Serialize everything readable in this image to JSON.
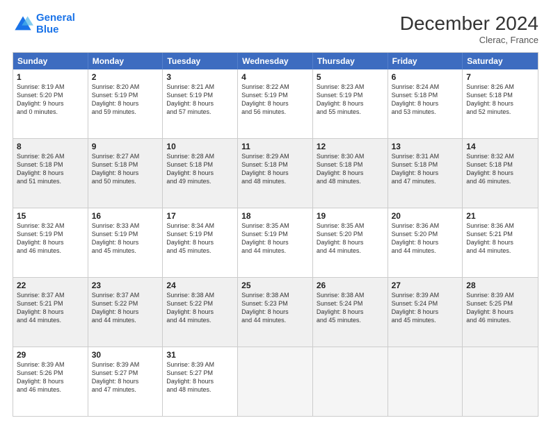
{
  "logo": {
    "line1": "General",
    "line2": "Blue"
  },
  "title": "December 2024",
  "subtitle": "Clerac, France",
  "header_days": [
    "Sunday",
    "Monday",
    "Tuesday",
    "Wednesday",
    "Thursday",
    "Friday",
    "Saturday"
  ],
  "weeks": [
    [
      {
        "day": "1",
        "lines": [
          "Sunrise: 8:19 AM",
          "Sunset: 5:20 PM",
          "Daylight: 9 hours",
          "and 0 minutes."
        ]
      },
      {
        "day": "2",
        "lines": [
          "Sunrise: 8:20 AM",
          "Sunset: 5:19 PM",
          "Daylight: 8 hours",
          "and 59 minutes."
        ]
      },
      {
        "day": "3",
        "lines": [
          "Sunrise: 8:21 AM",
          "Sunset: 5:19 PM",
          "Daylight: 8 hours",
          "and 57 minutes."
        ]
      },
      {
        "day": "4",
        "lines": [
          "Sunrise: 8:22 AM",
          "Sunset: 5:19 PM",
          "Daylight: 8 hours",
          "and 56 minutes."
        ]
      },
      {
        "day": "5",
        "lines": [
          "Sunrise: 8:23 AM",
          "Sunset: 5:19 PM",
          "Daylight: 8 hours",
          "and 55 minutes."
        ]
      },
      {
        "day": "6",
        "lines": [
          "Sunrise: 8:24 AM",
          "Sunset: 5:18 PM",
          "Daylight: 8 hours",
          "and 53 minutes."
        ]
      },
      {
        "day": "7",
        "lines": [
          "Sunrise: 8:26 AM",
          "Sunset: 5:18 PM",
          "Daylight: 8 hours",
          "and 52 minutes."
        ]
      }
    ],
    [
      {
        "day": "8",
        "lines": [
          "Sunrise: 8:26 AM",
          "Sunset: 5:18 PM",
          "Daylight: 8 hours",
          "and 51 minutes."
        ]
      },
      {
        "day": "9",
        "lines": [
          "Sunrise: 8:27 AM",
          "Sunset: 5:18 PM",
          "Daylight: 8 hours",
          "and 50 minutes."
        ]
      },
      {
        "day": "10",
        "lines": [
          "Sunrise: 8:28 AM",
          "Sunset: 5:18 PM",
          "Daylight: 8 hours",
          "and 49 minutes."
        ]
      },
      {
        "day": "11",
        "lines": [
          "Sunrise: 8:29 AM",
          "Sunset: 5:18 PM",
          "Daylight: 8 hours",
          "and 48 minutes."
        ]
      },
      {
        "day": "12",
        "lines": [
          "Sunrise: 8:30 AM",
          "Sunset: 5:18 PM",
          "Daylight: 8 hours",
          "and 48 minutes."
        ]
      },
      {
        "day": "13",
        "lines": [
          "Sunrise: 8:31 AM",
          "Sunset: 5:18 PM",
          "Daylight: 8 hours",
          "and 47 minutes."
        ]
      },
      {
        "day": "14",
        "lines": [
          "Sunrise: 8:32 AM",
          "Sunset: 5:18 PM",
          "Daylight: 8 hours",
          "and 46 minutes."
        ]
      }
    ],
    [
      {
        "day": "15",
        "lines": [
          "Sunrise: 8:32 AM",
          "Sunset: 5:19 PM",
          "Daylight: 8 hours",
          "and 46 minutes."
        ]
      },
      {
        "day": "16",
        "lines": [
          "Sunrise: 8:33 AM",
          "Sunset: 5:19 PM",
          "Daylight: 8 hours",
          "and 45 minutes."
        ]
      },
      {
        "day": "17",
        "lines": [
          "Sunrise: 8:34 AM",
          "Sunset: 5:19 PM",
          "Daylight: 8 hours",
          "and 45 minutes."
        ]
      },
      {
        "day": "18",
        "lines": [
          "Sunrise: 8:35 AM",
          "Sunset: 5:19 PM",
          "Daylight: 8 hours",
          "and 44 minutes."
        ]
      },
      {
        "day": "19",
        "lines": [
          "Sunrise: 8:35 AM",
          "Sunset: 5:20 PM",
          "Daylight: 8 hours",
          "and 44 minutes."
        ]
      },
      {
        "day": "20",
        "lines": [
          "Sunrise: 8:36 AM",
          "Sunset: 5:20 PM",
          "Daylight: 8 hours",
          "and 44 minutes."
        ]
      },
      {
        "day": "21",
        "lines": [
          "Sunrise: 8:36 AM",
          "Sunset: 5:21 PM",
          "Daylight: 8 hours",
          "and 44 minutes."
        ]
      }
    ],
    [
      {
        "day": "22",
        "lines": [
          "Sunrise: 8:37 AM",
          "Sunset: 5:21 PM",
          "Daylight: 8 hours",
          "and 44 minutes."
        ]
      },
      {
        "day": "23",
        "lines": [
          "Sunrise: 8:37 AM",
          "Sunset: 5:22 PM",
          "Daylight: 8 hours",
          "and 44 minutes."
        ]
      },
      {
        "day": "24",
        "lines": [
          "Sunrise: 8:38 AM",
          "Sunset: 5:22 PM",
          "Daylight: 8 hours",
          "and 44 minutes."
        ]
      },
      {
        "day": "25",
        "lines": [
          "Sunrise: 8:38 AM",
          "Sunset: 5:23 PM",
          "Daylight: 8 hours",
          "and 44 minutes."
        ]
      },
      {
        "day": "26",
        "lines": [
          "Sunrise: 8:38 AM",
          "Sunset: 5:24 PM",
          "Daylight: 8 hours",
          "and 45 minutes."
        ]
      },
      {
        "day": "27",
        "lines": [
          "Sunrise: 8:39 AM",
          "Sunset: 5:24 PM",
          "Daylight: 8 hours",
          "and 45 minutes."
        ]
      },
      {
        "day": "28",
        "lines": [
          "Sunrise: 8:39 AM",
          "Sunset: 5:25 PM",
          "Daylight: 8 hours",
          "and 46 minutes."
        ]
      }
    ],
    [
      {
        "day": "29",
        "lines": [
          "Sunrise: 8:39 AM",
          "Sunset: 5:26 PM",
          "Daylight: 8 hours",
          "and 46 minutes."
        ]
      },
      {
        "day": "30",
        "lines": [
          "Sunrise: 8:39 AM",
          "Sunset: 5:27 PM",
          "Daylight: 8 hours",
          "and 47 minutes."
        ]
      },
      {
        "day": "31",
        "lines": [
          "Sunrise: 8:39 AM",
          "Sunset: 5:27 PM",
          "Daylight: 8 hours",
          "and 48 minutes."
        ]
      },
      {
        "day": "",
        "lines": []
      },
      {
        "day": "",
        "lines": []
      },
      {
        "day": "",
        "lines": []
      },
      {
        "day": "",
        "lines": []
      }
    ]
  ]
}
